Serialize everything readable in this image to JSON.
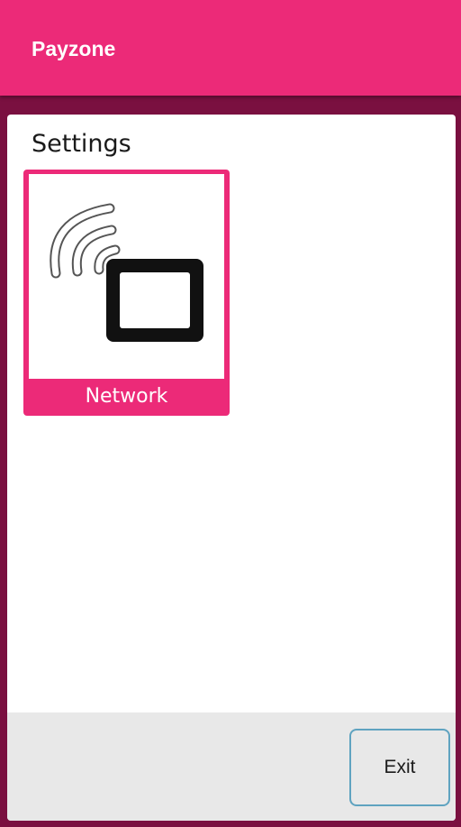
{
  "app_bar": {
    "title": "Payzone",
    "background_color": "#ec2a78"
  },
  "settings": {
    "title": "Settings",
    "tiles": [
      {
        "label": "Network",
        "icon": "network-terminal-icon",
        "accent_color": "#ec2a78"
      }
    ]
  },
  "footer": {
    "exit_label": "Exit"
  },
  "colors": {
    "frame": "#7a1040",
    "accent": "#ec2a78",
    "exit_border": "#5fa3c0"
  }
}
